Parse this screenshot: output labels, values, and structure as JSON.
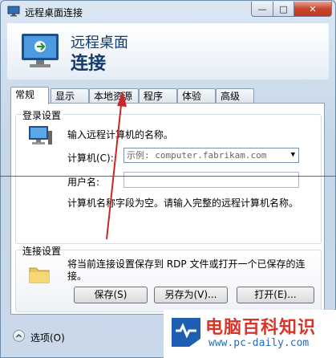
{
  "window": {
    "title": "远程桌面连接",
    "controls": {
      "minimize": "—",
      "maximize": "□",
      "close": "✕"
    }
  },
  "banner": {
    "line1": "远程桌面",
    "line2": "连接"
  },
  "tabs": [
    "常规",
    "显示",
    "本地资源",
    "程序",
    "体验",
    "高级"
  ],
  "login": {
    "legend": "登录设置",
    "prompt": "输入远程计算机的名称。",
    "computer_label": "计算机(C):",
    "computer_placeholder": "示例: computer.fabrikam.com",
    "username_label": "用户名:",
    "username_value": "",
    "warning": "计算机名称字段为空。请输入完整的远程计算机名称。"
  },
  "connection": {
    "legend": "连接设置",
    "description": "将当前连接设置保存到 RDP 文件或打开一个已保存的连接。",
    "buttons": {
      "save": "保存(S)",
      "save_as": "另存为(V)...",
      "open": "打开(E)..."
    }
  },
  "footer": {
    "options": "选项(O)"
  },
  "watermark": {
    "title": "电脑百科知识",
    "url": "www.pc-daily.com"
  },
  "colors": {
    "banner_text": "#123a6b",
    "annotation_red": "#c82828",
    "watermark_red": "#d8352a",
    "watermark_blue": "#2a6bb5"
  }
}
